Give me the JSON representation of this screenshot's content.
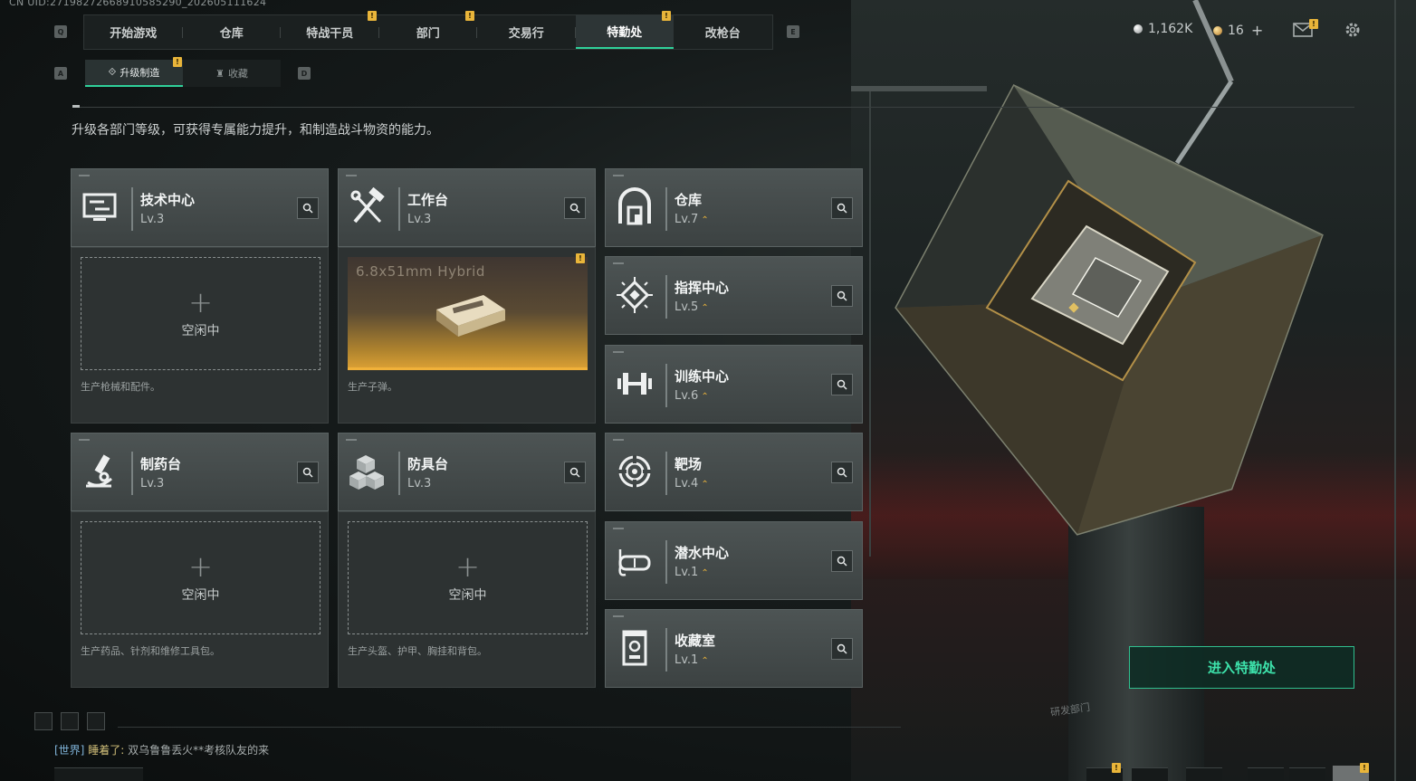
{
  "uid": "CN UID:27198272668910585290_202605111624",
  "top_tabs": [
    {
      "label": "开始游戏",
      "active": false,
      "notice": false
    },
    {
      "label": "仓库",
      "active": false,
      "notice": false
    },
    {
      "label": "特战干员",
      "active": false,
      "notice": true
    },
    {
      "label": "部门",
      "active": false,
      "notice": true
    },
    {
      "label": "交易行",
      "active": false,
      "notice": false
    },
    {
      "label": "特勤处",
      "active": true,
      "notice": true
    },
    {
      "label": "改枪台",
      "active": false,
      "notice": false
    }
  ],
  "key_hints": {
    "tab_left": "Q",
    "tab_right": "E",
    "sub_left": "A",
    "sub_right": "D"
  },
  "notice_glyph": "!",
  "sub_tabs": [
    {
      "label": "升级制造",
      "active": true
    },
    {
      "label": "收藏",
      "active": false
    }
  ],
  "currency": {
    "silver": "1,162K",
    "gold": "16",
    "plus": "+"
  },
  "description": "升级各部门等级，可获得专属能力提升，和制造战斗物资的能力。",
  "production_departments": [
    {
      "name": "技术中心",
      "level": "Lv.3",
      "icon": "computer-icon",
      "status": "空闲中",
      "caption": "生产枪械和配件。"
    },
    {
      "name": "工作台",
      "level": "Lv.3",
      "icon": "hammer-wrench-icon",
      "product": "6.8x51mm Hybrid",
      "caption": "生产子弹。"
    },
    {
      "name": "制药台",
      "level": "Lv.3",
      "icon": "microscope-icon",
      "status": "空闲中",
      "caption": "生产药品、针剂和维修工具包。"
    },
    {
      "name": "防具台",
      "level": "Lv.3",
      "icon": "armor-blocks-icon",
      "status": "空闲中",
      "caption": "生产头盔、护甲、胸挂和背包。"
    }
  ],
  "other_departments": [
    {
      "name": "仓库",
      "level": "Lv.7",
      "icon": "warehouse-icon",
      "upgrade": "⌃"
    },
    {
      "name": "指挥中心",
      "level": "Lv.5",
      "icon": "command-chip-icon",
      "upgrade": "⌃"
    },
    {
      "name": "训练中心",
      "level": "Lv.6",
      "icon": "dumbbell-icon",
      "upgrade": "⌃"
    },
    {
      "name": "靶场",
      "level": "Lv.4",
      "icon": "target-icon",
      "upgrade": "⌃"
    },
    {
      "name": "潜水中心",
      "level": "Lv.1",
      "icon": "diving-mask-icon",
      "upgrade": "⌃"
    },
    {
      "name": "收藏室",
      "level": "Lv.1",
      "icon": "collection-case-icon",
      "upgrade": "⌃"
    }
  ],
  "enter_button": "进入特勤处",
  "chat": {
    "channel": "[世界]",
    "speaker": "睡着了:",
    "message": "双乌鲁鲁丢火**考核队友的来"
  },
  "scene_label": "研发部门",
  "colors": {
    "accent": "#2fd19a",
    "notice": "#e9b53a",
    "gold": "#f0b13a"
  }
}
